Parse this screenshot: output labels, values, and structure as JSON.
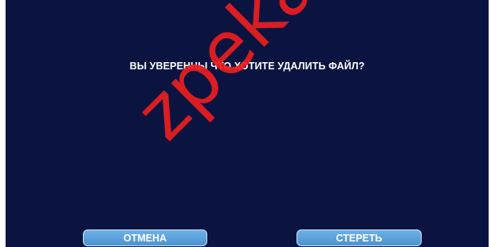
{
  "dialog": {
    "message": "ВЫ УВЕРЕННЫ ЧТО ХОТИТЕ УДАЛИТЬ ФАЙЛ?",
    "cancel_label": "ОТМЕНА",
    "delete_label": "СТЕРЕТЬ"
  },
  "watermark": {
    "text": "zpeka-s"
  },
  "colors": {
    "background": "#0b1440",
    "button": "#5aa0dc",
    "button_border": "#cfe3f6",
    "text": "#ffffff",
    "watermark": "#eb1e1e"
  }
}
